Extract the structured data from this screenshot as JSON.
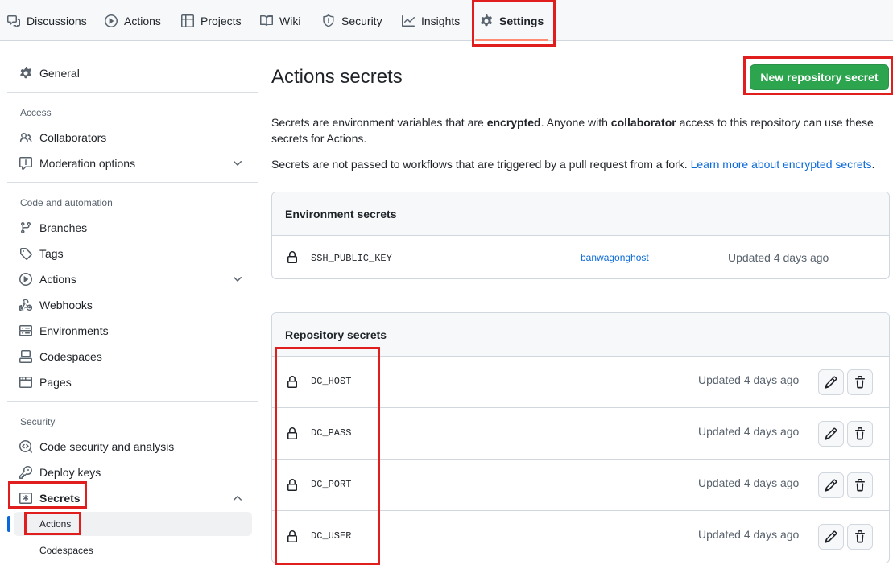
{
  "nav": {
    "tabs": [
      {
        "label": "Discussions",
        "icon": "comment-discussion-icon"
      },
      {
        "label": "Actions",
        "icon": "play-icon"
      },
      {
        "label": "Projects",
        "icon": "table-icon"
      },
      {
        "label": "Wiki",
        "icon": "book-icon"
      },
      {
        "label": "Security",
        "icon": "shield-icon"
      },
      {
        "label": "Insights",
        "icon": "graph-icon"
      },
      {
        "label": "Settings",
        "icon": "gear-icon",
        "active": true
      }
    ]
  },
  "sidebar": {
    "general": "General",
    "access_heading": "Access",
    "collaborators": "Collaborators",
    "moderation": "Moderation options",
    "code_heading": "Code and automation",
    "branches": "Branches",
    "tags": "Tags",
    "actions": "Actions",
    "webhooks": "Webhooks",
    "environments": "Environments",
    "codespaces": "Codespaces",
    "pages": "Pages",
    "security_heading": "Security",
    "code_security": "Code security and analysis",
    "deploy_keys": "Deploy keys",
    "secrets": "Secrets",
    "secrets_actions": "Actions",
    "secrets_codespaces": "Codespaces"
  },
  "main": {
    "title": "Actions secrets",
    "new_button": "New repository secret",
    "desc1_a": "Secrets are environment variables that are ",
    "desc1_b": "encrypted",
    "desc1_c": ". Anyone with ",
    "desc1_d": "collaborator",
    "desc1_e": " access to this repository can use these secrets for Actions.",
    "desc2": "Secrets are not passed to workflows that are triggered by a pull request from a fork. ",
    "desc2_link": "Learn more about encrypted secrets",
    "desc2_end": ".",
    "env_heading": "Environment secrets",
    "env_secret": {
      "name": "SSH_PUBLIC_KEY",
      "environment": "banwagonghost",
      "updated": "Updated 4 days ago"
    },
    "repo_heading": "Repository secrets",
    "repo_secrets": [
      {
        "name": "DC_HOST",
        "updated": "Updated 4 days ago"
      },
      {
        "name": "DC_PASS",
        "updated": "Updated 4 days ago"
      },
      {
        "name": "DC_PORT",
        "updated": "Updated 4 days ago"
      },
      {
        "name": "DC_USER",
        "updated": "Updated 4 days ago"
      }
    ]
  },
  "colors": {
    "primary_button": "#2da44e",
    "link": "#0969da",
    "highlight": "#e01e1e",
    "active_tab_underline": "#fd8c73"
  }
}
